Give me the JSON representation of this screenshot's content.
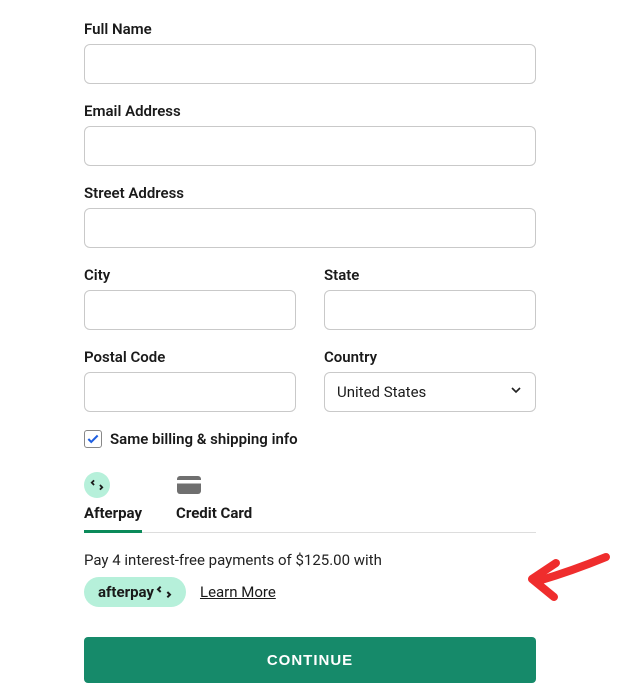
{
  "fields": {
    "full_name": {
      "label": "Full Name",
      "value": ""
    },
    "email": {
      "label": "Email Address",
      "value": ""
    },
    "street": {
      "label": "Street Address",
      "value": ""
    },
    "city": {
      "label": "City",
      "value": ""
    },
    "state": {
      "label": "State",
      "value": ""
    },
    "postal": {
      "label": "Postal Code",
      "value": ""
    },
    "country": {
      "label": "Country",
      "value": "United States"
    }
  },
  "billing_same": {
    "label": "Same billing & shipping info",
    "checked": true
  },
  "tabs": {
    "afterpay": "Afterpay",
    "credit": "Credit Card",
    "active": "afterpay"
  },
  "afterpay_message": "Pay 4 interest-free payments of $125.00 with",
  "afterpay_badge": "afterpay",
  "learn_more": "Learn More",
  "continue": "CONTINUE"
}
